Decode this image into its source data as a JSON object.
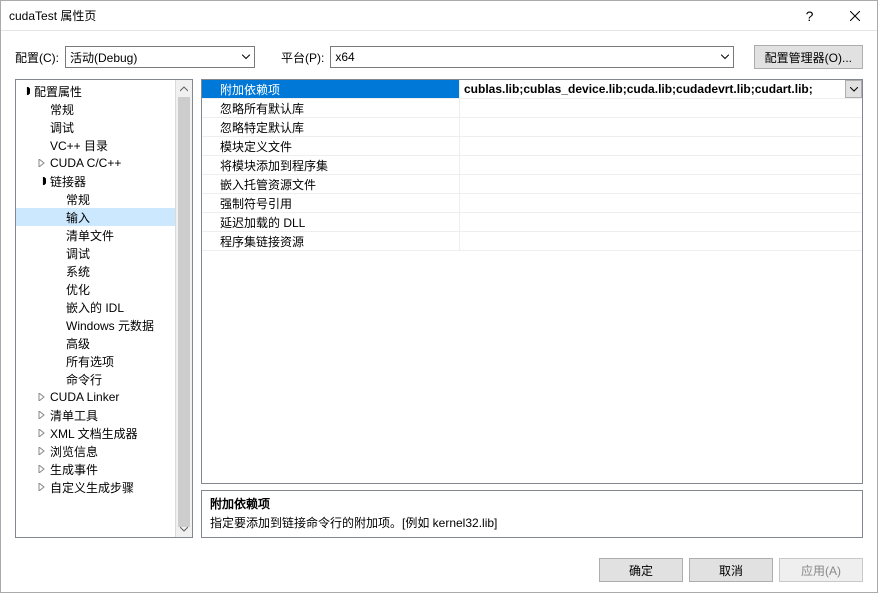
{
  "title": "cudaTest 属性页",
  "configLabel": "配置(C):",
  "configValue": "活动(Debug)",
  "platformLabel": "平台(P):",
  "platformValue": "x64",
  "configManagerLabel": "配置管理器(O)...",
  "tree": {
    "root": "配置属性",
    "items": [
      "常规",
      "调试",
      "VC++ 目录",
      "CUDA C/C++",
      "链接器"
    ],
    "linkerChildren": [
      "常规",
      "输入",
      "清单文件",
      "调试",
      "系统",
      "优化",
      "嵌入的 IDL",
      "Windows 元数据",
      "高级",
      "所有选项",
      "命令行"
    ],
    "after": [
      "CUDA Linker",
      "清单工具",
      "XML 文档生成器",
      "浏览信息",
      "生成事件",
      "自定义生成步骤"
    ]
  },
  "props": [
    {
      "name": "附加依赖项",
      "value": "cublas.lib;cublas_device.lib;cuda.lib;cudadevrt.lib;cudart.lib;"
    },
    {
      "name": "忽略所有默认库",
      "value": ""
    },
    {
      "name": "忽略特定默认库",
      "value": ""
    },
    {
      "name": "模块定义文件",
      "value": ""
    },
    {
      "name": "将模块添加到程序集",
      "value": ""
    },
    {
      "name": "嵌入托管资源文件",
      "value": ""
    },
    {
      "name": "强制符号引用",
      "value": ""
    },
    {
      "name": "延迟加载的 DLL",
      "value": ""
    },
    {
      "name": "程序集链接资源",
      "value": ""
    }
  ],
  "desc": {
    "title": "附加依赖项",
    "body": "指定要添加到链接命令行的附加项。[例如 kernel32.lib]"
  },
  "buttons": {
    "ok": "确定",
    "cancel": "取消",
    "apply": "应用(A)"
  }
}
